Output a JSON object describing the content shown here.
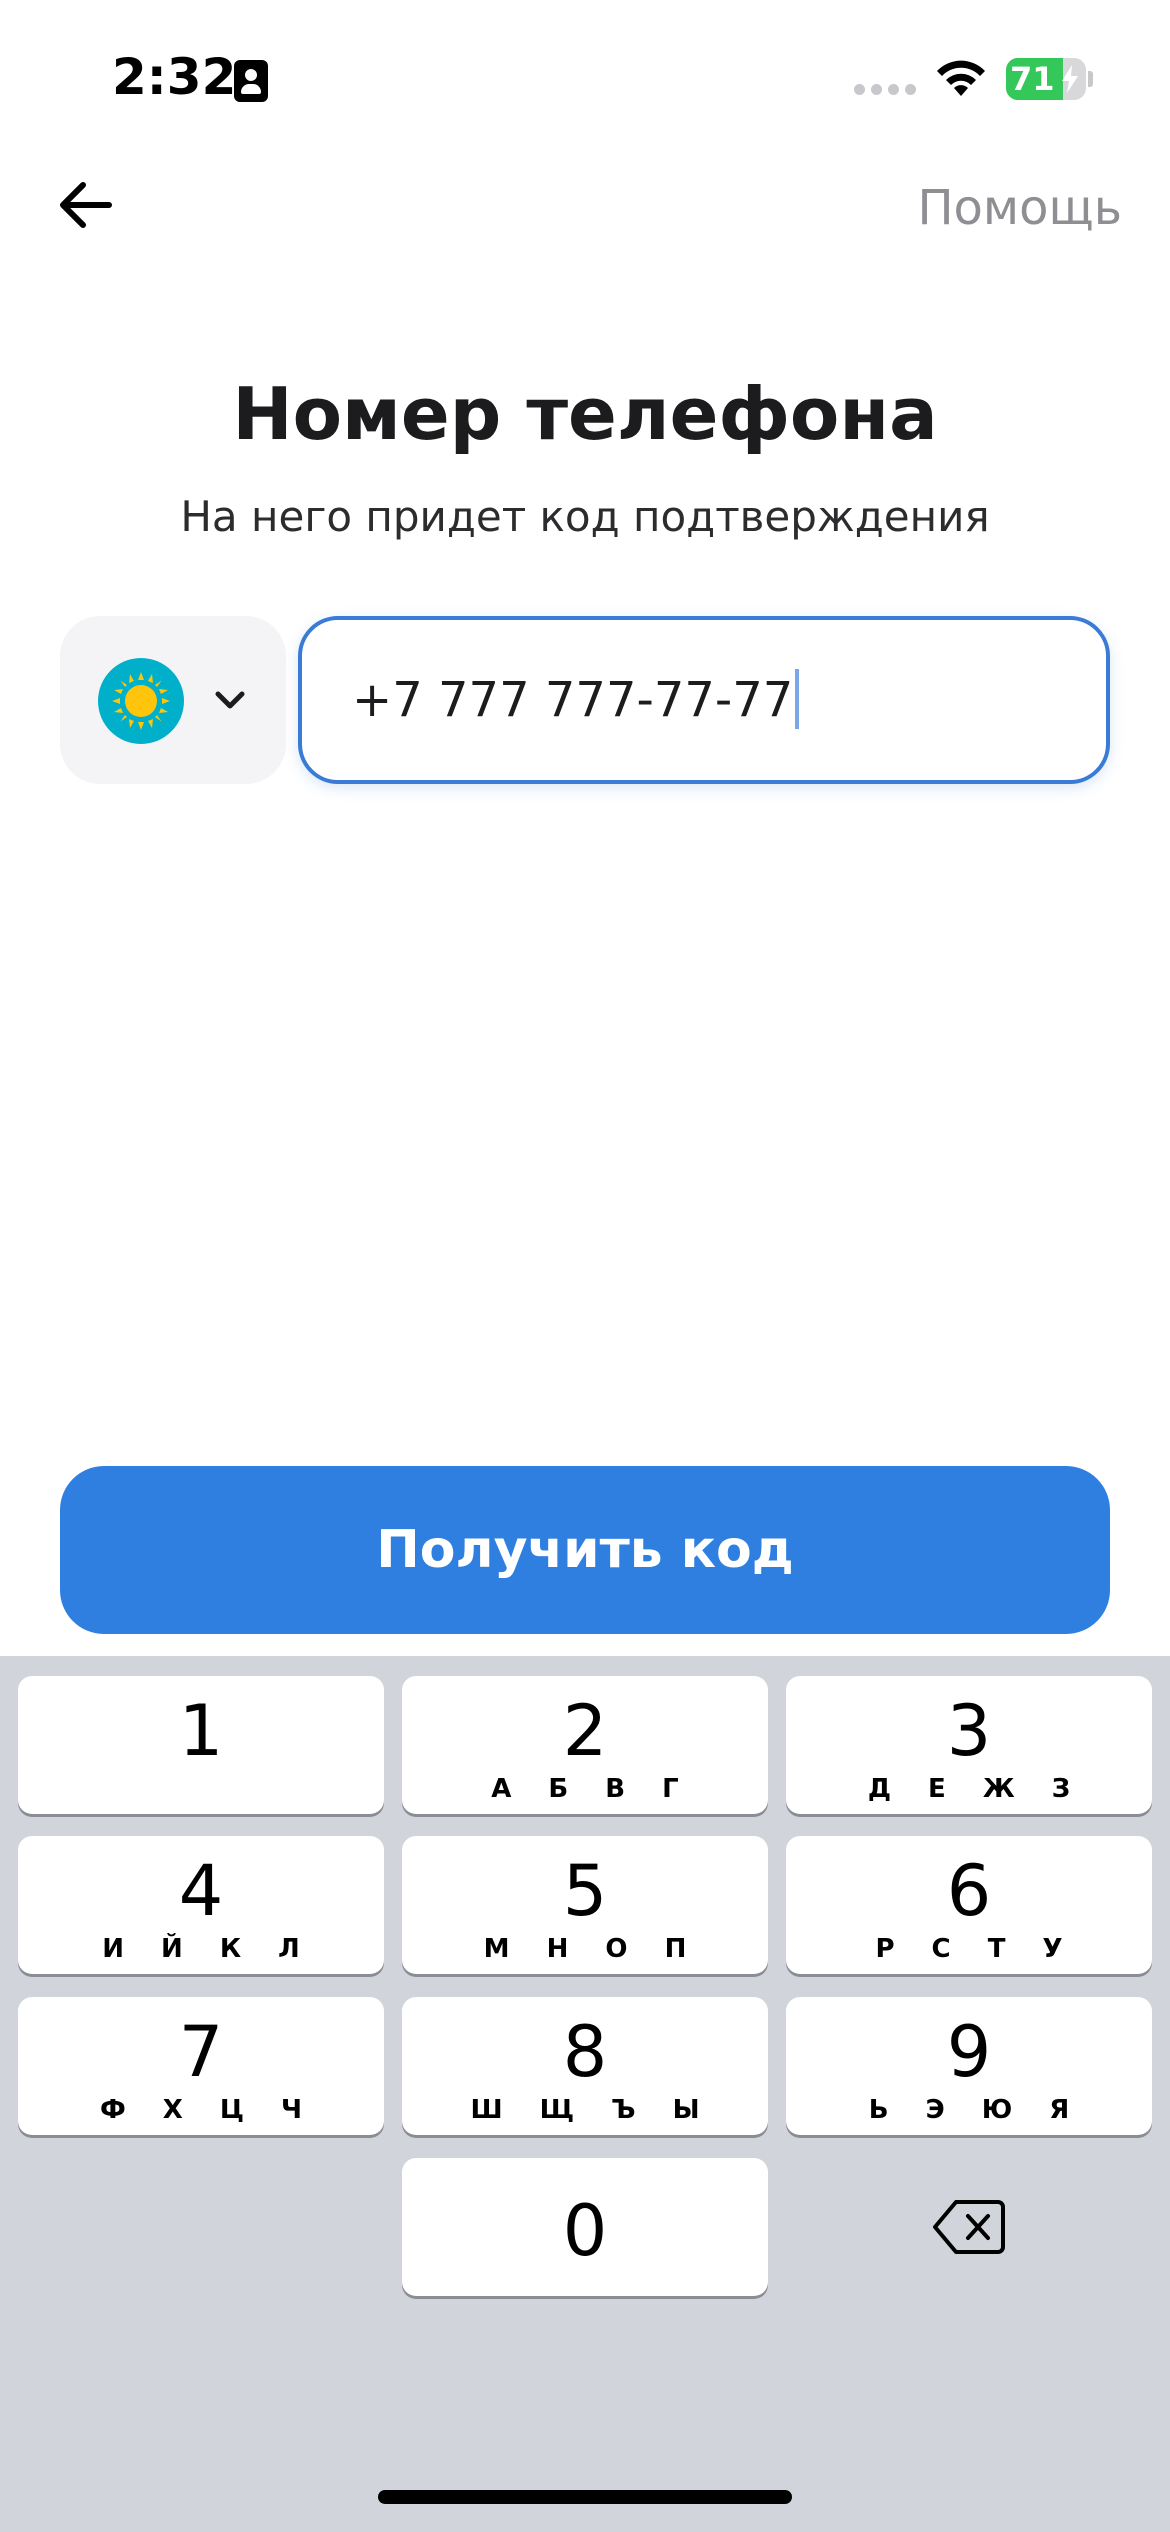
{
  "status_bar": {
    "time": "2:32",
    "battery_level": "71",
    "battery_fill_fraction": 0.71
  },
  "nav": {
    "help_label": "Помощь"
  },
  "header": {
    "title": "Номер телефона",
    "subtitle": "На него придет код подтверждения"
  },
  "phone": {
    "value": "+7 777 777-77-77"
  },
  "actions": {
    "submit_label": "Получить код"
  },
  "keypad": {
    "keys": [
      {
        "digit": "1",
        "letters": ""
      },
      {
        "digit": "2",
        "letters": "А Б В Г"
      },
      {
        "digit": "3",
        "letters": "Д Е Ж З"
      },
      {
        "digit": "4",
        "letters": "И Й К Л"
      },
      {
        "digit": "5",
        "letters": "М Н О П"
      },
      {
        "digit": "6",
        "letters": "Р С Т У"
      },
      {
        "digit": "7",
        "letters": "Ф Х Ц Ч"
      },
      {
        "digit": "8",
        "letters": "Ш Щ Ъ Ы"
      },
      {
        "digit": "9",
        "letters": "Ь Э Ю Я"
      },
      {
        "digit": "0",
        "letters": ""
      }
    ]
  },
  "colors": {
    "accent": "#2f7fe0",
    "input_border": "#3a7bd5",
    "flag_blue": "#00afca",
    "flag_sun": "#fec50c"
  },
  "icons": {
    "back": "arrow-left-icon",
    "country_flag": "kazakhstan-flag-icon",
    "dropdown": "chevron-down-icon",
    "delete": "backspace-icon"
  }
}
